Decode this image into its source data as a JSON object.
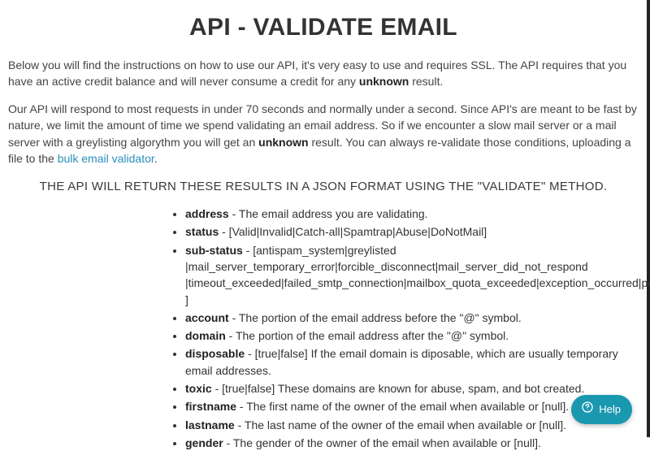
{
  "title": "API - VALIDATE EMAIL",
  "intro1_a": "Below you will find the instructions on how to use our API, it's very easy to use and requires SSL. The API requires that you have an active credit balance and will never consume a credit for any ",
  "intro1_bold": "unknown",
  "intro1_b": " result.",
  "intro2_a": "Our API will respond to most requests in under 70 seconds and normally under a second. Since API's are meant to be fast by nature, we limit the amount of time we spend validating an email address. So if we encounter a slow mail server or a mail server with a greylisting algorythm you will get an ",
  "intro2_bold": "unknown",
  "intro2_b": " result. You can always re-validate those conditions, uploading a file to the ",
  "intro2_link": "bulk email validator",
  "intro2_c": ".",
  "subheading": "THE API WILL RETURN THESE RESULTS IN A JSON FORMAT USING THE \"VALIDATE\" METHOD.",
  "fields": [
    {
      "term": "address",
      "desc": " - The email address you are validating."
    },
    {
      "term": "status",
      "desc": " - [Valid|Invalid|Catch-all|Spamtrap|Abuse|DoNotMail]"
    },
    {
      "term": "sub-status",
      "desc": " - [antispam_system|greylisted |mail_server_temporary_error|forcible_disconnect|mail_server_did_not_respond |timeout_exceeded|failed_smtp_connection|mailbox_quota_exceeded|exception_occurred|possible_traps ]"
    },
    {
      "term": "account",
      "desc": " - The portion of the email address before the \"@\" symbol."
    },
    {
      "term": "domain",
      "desc": " - The portion of the email address after the \"@\" symbol."
    },
    {
      "term": "disposable",
      "desc": " - [true|false] If the email domain is diposable, which are usually temporary email addresses."
    },
    {
      "term": "toxic",
      "desc": " - [true|false] These domains are known for abuse, spam, and bot created."
    },
    {
      "term": "firstname",
      "desc": " - The first name of the owner of the email when available or [null]."
    },
    {
      "term": "lastname",
      "desc": " - The last name of the owner of the email when available or [null]."
    },
    {
      "term": "gender",
      "desc": " - The gender of the owner of the email when available or [null]."
    }
  ],
  "help_label": "Help"
}
